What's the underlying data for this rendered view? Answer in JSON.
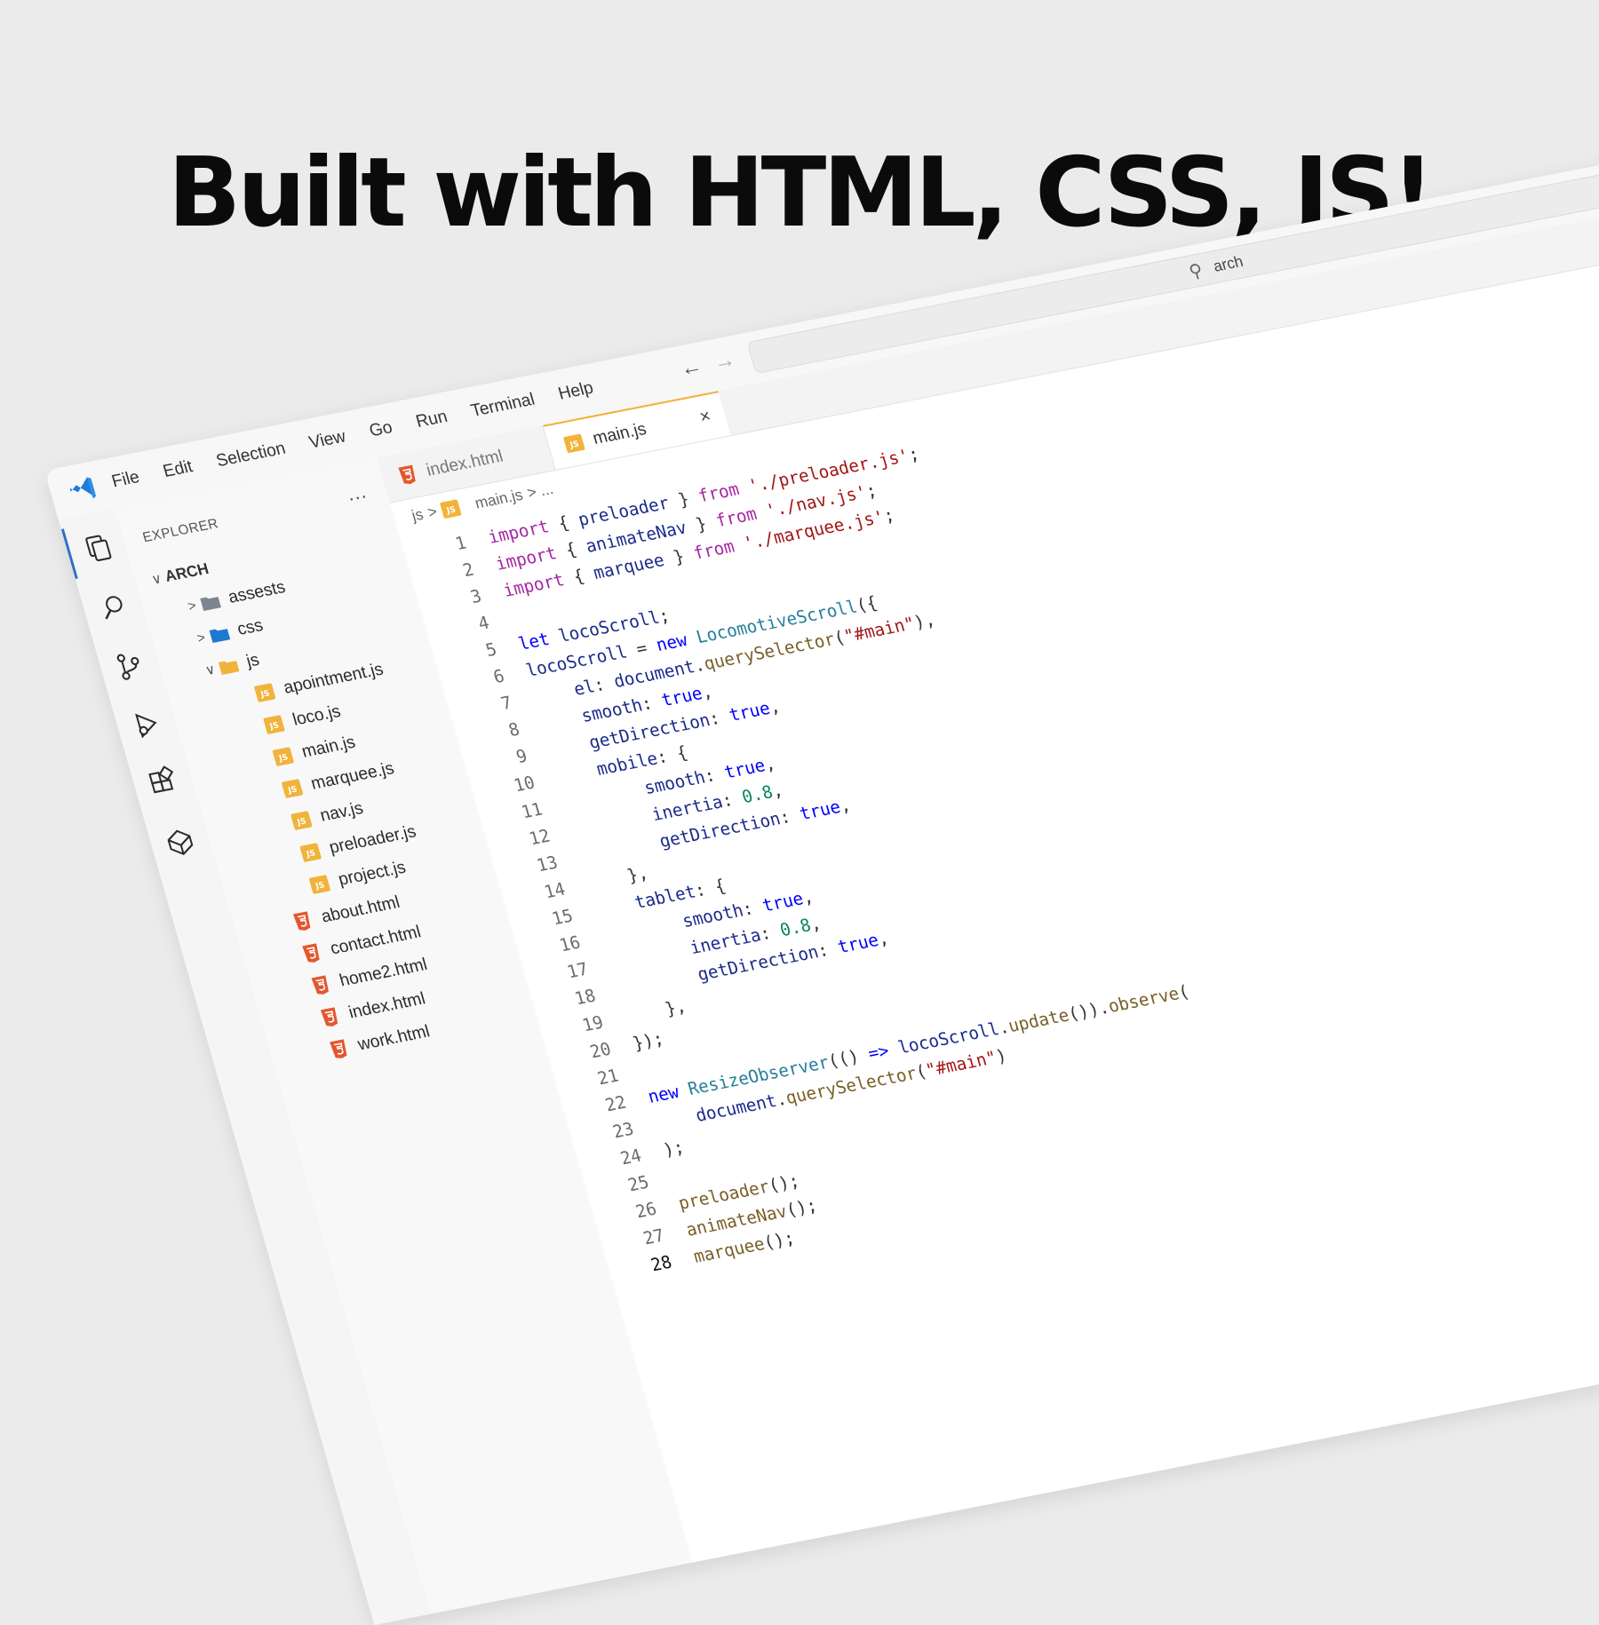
{
  "headline": "Built with HTML, CSS, JS!",
  "menu": [
    "File",
    "Edit",
    "Selection",
    "View",
    "Go",
    "Run",
    "Terminal",
    "Help"
  ],
  "nav": {
    "back": "←",
    "forward": "→"
  },
  "search": {
    "value": "arch",
    "icon": "search-icon"
  },
  "activity_bar": [
    "explorer-icon",
    "search-icon",
    "source-control-icon",
    "run-debug-icon",
    "extensions-icon",
    "remote-explorer-icon"
  ],
  "sidebar": {
    "title": "EXPLORER",
    "more": "...",
    "root": "ARCH",
    "items": [
      {
        "label": "assests",
        "kind": "folder",
        "depth": 1,
        "chevron": ">"
      },
      {
        "label": "css",
        "kind": "folder-css",
        "depth": 1,
        "chevron": ">"
      },
      {
        "label": "js",
        "kind": "folder-js",
        "depth": 1,
        "chevron": "∨"
      },
      {
        "label": "apointment.js",
        "kind": "js",
        "depth": 2
      },
      {
        "label": "loco.js",
        "kind": "js",
        "depth": 2
      },
      {
        "label": "main.js",
        "kind": "js",
        "depth": 2
      },
      {
        "label": "marquee.js",
        "kind": "js",
        "depth": 2
      },
      {
        "label": "nav.js",
        "kind": "js",
        "depth": 2
      },
      {
        "label": "preloader.js",
        "kind": "js",
        "depth": 2
      },
      {
        "label": "project.js",
        "kind": "js",
        "depth": 2
      },
      {
        "label": "about.html",
        "kind": "html",
        "depth": 1
      },
      {
        "label": "contact.html",
        "kind": "html",
        "depth": 1
      },
      {
        "label": "home2.html",
        "kind": "html",
        "depth": 1
      },
      {
        "label": "index.html",
        "kind": "html",
        "depth": 1
      },
      {
        "label": "work.html",
        "kind": "html",
        "depth": 1
      }
    ]
  },
  "tabs": [
    {
      "label": "index.html",
      "kind": "html",
      "active": false
    },
    {
      "label": "main.js",
      "kind": "js",
      "active": true,
      "close": "×"
    }
  ],
  "breadcrumb": {
    "folder": "js",
    "sep": ">",
    "file": "main.js",
    "more": "> ..."
  },
  "code_lines": [
    [
      [
        "kw",
        "import"
      ],
      [
        "p",
        " { "
      ],
      [
        "id",
        "preloader"
      ],
      [
        "p",
        " } "
      ],
      [
        "kw",
        "from"
      ],
      [
        "str",
        " './preloader.js'"
      ],
      [
        "p",
        ";"
      ]
    ],
    [
      [
        "kw",
        "import"
      ],
      [
        "p",
        " { "
      ],
      [
        "id",
        "animateNav"
      ],
      [
        "p",
        " } "
      ],
      [
        "kw",
        "from"
      ],
      [
        "str",
        " './nav.js'"
      ],
      [
        "p",
        ";"
      ]
    ],
    [
      [
        "kw",
        "import"
      ],
      [
        "p",
        " { "
      ],
      [
        "id",
        "marquee"
      ],
      [
        "p",
        " } "
      ],
      [
        "kw",
        "from"
      ],
      [
        "str",
        " './marquee.js'"
      ],
      [
        "p",
        ";"
      ]
    ],
    [],
    [
      [
        "key",
        "let"
      ],
      [
        "p",
        " "
      ],
      [
        "id",
        "locoScroll"
      ],
      [
        "p",
        ";"
      ]
    ],
    [
      [
        "id",
        "locoScroll"
      ],
      [
        "p",
        " = "
      ],
      [
        "key",
        "new"
      ],
      [
        "p",
        " "
      ],
      [
        "cls",
        "LocomotiveScroll"
      ],
      [
        "p",
        "({"
      ]
    ],
    [
      [
        "p",
        "    "
      ],
      [
        "id",
        "el"
      ],
      [
        "p",
        ": "
      ],
      [
        "id",
        "document"
      ],
      [
        "p",
        "."
      ],
      [
        "fn",
        "querySelector"
      ],
      [
        "p",
        "("
      ],
      [
        "str",
        "\"#main\""
      ],
      [
        "p",
        "),"
      ]
    ],
    [
      [
        "p",
        "    "
      ],
      [
        "id",
        "smooth"
      ],
      [
        "p",
        ": "
      ],
      [
        "key",
        "true"
      ],
      [
        "p",
        ","
      ]
    ],
    [
      [
        "p",
        "    "
      ],
      [
        "id",
        "getDirection"
      ],
      [
        "p",
        ": "
      ],
      [
        "key",
        "true"
      ],
      [
        "p",
        ","
      ]
    ],
    [
      [
        "p",
        "    "
      ],
      [
        "id",
        "mobile"
      ],
      [
        "p",
        ": {"
      ]
    ],
    [
      [
        "p",
        "        "
      ],
      [
        "id",
        "smooth"
      ],
      [
        "p",
        ": "
      ],
      [
        "key",
        "true"
      ],
      [
        "p",
        ","
      ]
    ],
    [
      [
        "p",
        "        "
      ],
      [
        "id",
        "inertia"
      ],
      [
        "p",
        ": "
      ],
      [
        "num",
        "0.8"
      ],
      [
        "p",
        ","
      ]
    ],
    [
      [
        "p",
        "        "
      ],
      [
        "id",
        "getDirection"
      ],
      [
        "p",
        ": "
      ],
      [
        "key",
        "true"
      ],
      [
        "p",
        ","
      ]
    ],
    [
      [
        "p",
        "    },"
      ]
    ],
    [
      [
        "p",
        "    "
      ],
      [
        "id",
        "tablet"
      ],
      [
        "p",
        ": {"
      ]
    ],
    [
      [
        "p",
        "        "
      ],
      [
        "id",
        "smooth"
      ],
      [
        "p",
        ": "
      ],
      [
        "key",
        "true"
      ],
      [
        "p",
        ","
      ]
    ],
    [
      [
        "p",
        "        "
      ],
      [
        "id",
        "inertia"
      ],
      [
        "p",
        ": "
      ],
      [
        "num",
        "0.8"
      ],
      [
        "p",
        ","
      ]
    ],
    [
      [
        "p",
        "        "
      ],
      [
        "id",
        "getDirection"
      ],
      [
        "p",
        ": "
      ],
      [
        "key",
        "true"
      ],
      [
        "p",
        ","
      ]
    ],
    [
      [
        "p",
        "    },"
      ]
    ],
    [
      [
        "p",
        "});"
      ]
    ],
    [],
    [
      [
        "key",
        "new"
      ],
      [
        "p",
        " "
      ],
      [
        "cls",
        "ResizeObserver"
      ],
      [
        "p",
        "(() "
      ],
      [
        "key",
        "=>"
      ],
      [
        "p",
        " "
      ],
      [
        "id",
        "locoScroll"
      ],
      [
        "p",
        "."
      ],
      [
        "fn",
        "update"
      ],
      [
        "p",
        "())."
      ],
      [
        "fn",
        "observe"
      ],
      [
        "p",
        "("
      ]
    ],
    [
      [
        "p",
        "    "
      ],
      [
        "id",
        "document"
      ],
      [
        "p",
        "."
      ],
      [
        "fn",
        "querySelector"
      ],
      [
        "p",
        "("
      ],
      [
        "str",
        "\"#main\""
      ],
      [
        "p",
        ")"
      ]
    ],
    [
      [
        "p",
        ");"
      ]
    ],
    [],
    [
      [
        "fn",
        "preloader"
      ],
      [
        "p",
        "();"
      ]
    ],
    [
      [
        "fn",
        "animateNav"
      ],
      [
        "p",
        "();"
      ]
    ],
    [
      [
        "fn",
        "marquee"
      ],
      [
        "p",
        "();"
      ]
    ]
  ],
  "current_line": 28,
  "colors": {
    "accent": "#2d6fc7",
    "js": "#f1b33b",
    "html": "#e4572e",
    "css_folder": "#1e78d2"
  }
}
